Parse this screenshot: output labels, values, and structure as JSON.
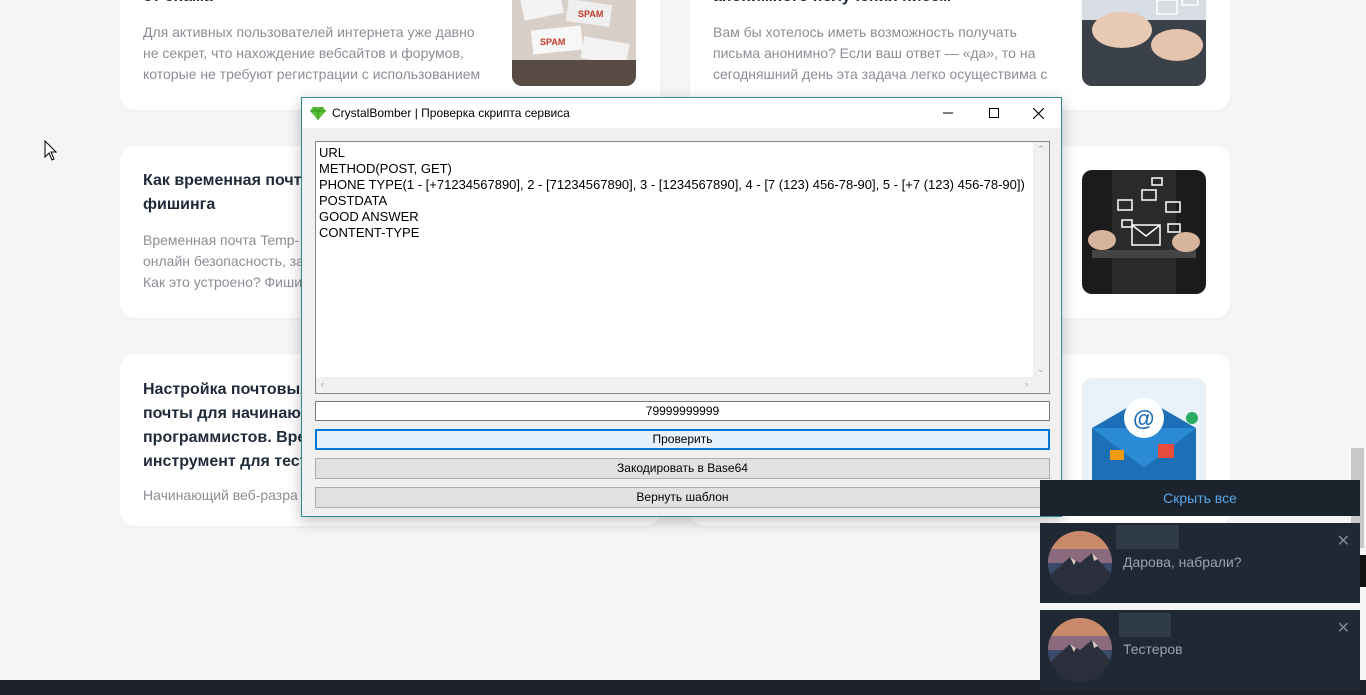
{
  "page": {
    "cards": [
      {
        "title": "от спама",
        "text": "Для активных пользователей интернета уже давно\nне секрет, что нахождение вебсайтов и форумов,\nкоторые не требуют регистрации с использованием"
      },
      {
        "title": "анонимного получения писем",
        "text": "Вам бы хотелось иметь возможность получать\nписьма анонимно? Если ваш ответ — «да», то на\nсегодняшний день эта задача легко осуществима с"
      },
      {
        "title": "Как временная почта\nфишинга",
        "text": "Временная почта Temp-\nонлайн безопасность, за\nКак это устроено? Фиши"
      },
      {
        "title": "Настройка почтовых\nпочты для начинаю\nпрограммистов. Вре\nинструмент для тест",
        "text": "Начинающий веб-разра"
      }
    ]
  },
  "dialog": {
    "title": "CrystalBomber | Проверка скрипта сервиса",
    "editor_lines": [
      "URL",
      "METHOD(POST, GET)",
      "PHONE TYPE(1 - [+71234567890], 2 - [71234567890], 3 - [1234567890], 4 - [7 (123) 456-78-90], 5 - [+7 (123) 456-78-90])",
      "POSTDATA",
      "GOOD ANSWER",
      "CONTENT-TYPE"
    ],
    "phone_value": "79999999999",
    "buttons": {
      "check": "Проверить",
      "encode": "Закодировать в Base64",
      "restore": "Вернуть шаблон"
    }
  },
  "notifications": {
    "hide_all": "Скрыть все",
    "items": [
      {
        "message": "Дарова, набрали?"
      },
      {
        "message": "Тестеров"
      }
    ]
  },
  "colors": {
    "accent": "#0078d7",
    "window_border": "#2e8b8b",
    "link_blue": "#5aa8e6",
    "notif_bg": "#1f2833"
  }
}
